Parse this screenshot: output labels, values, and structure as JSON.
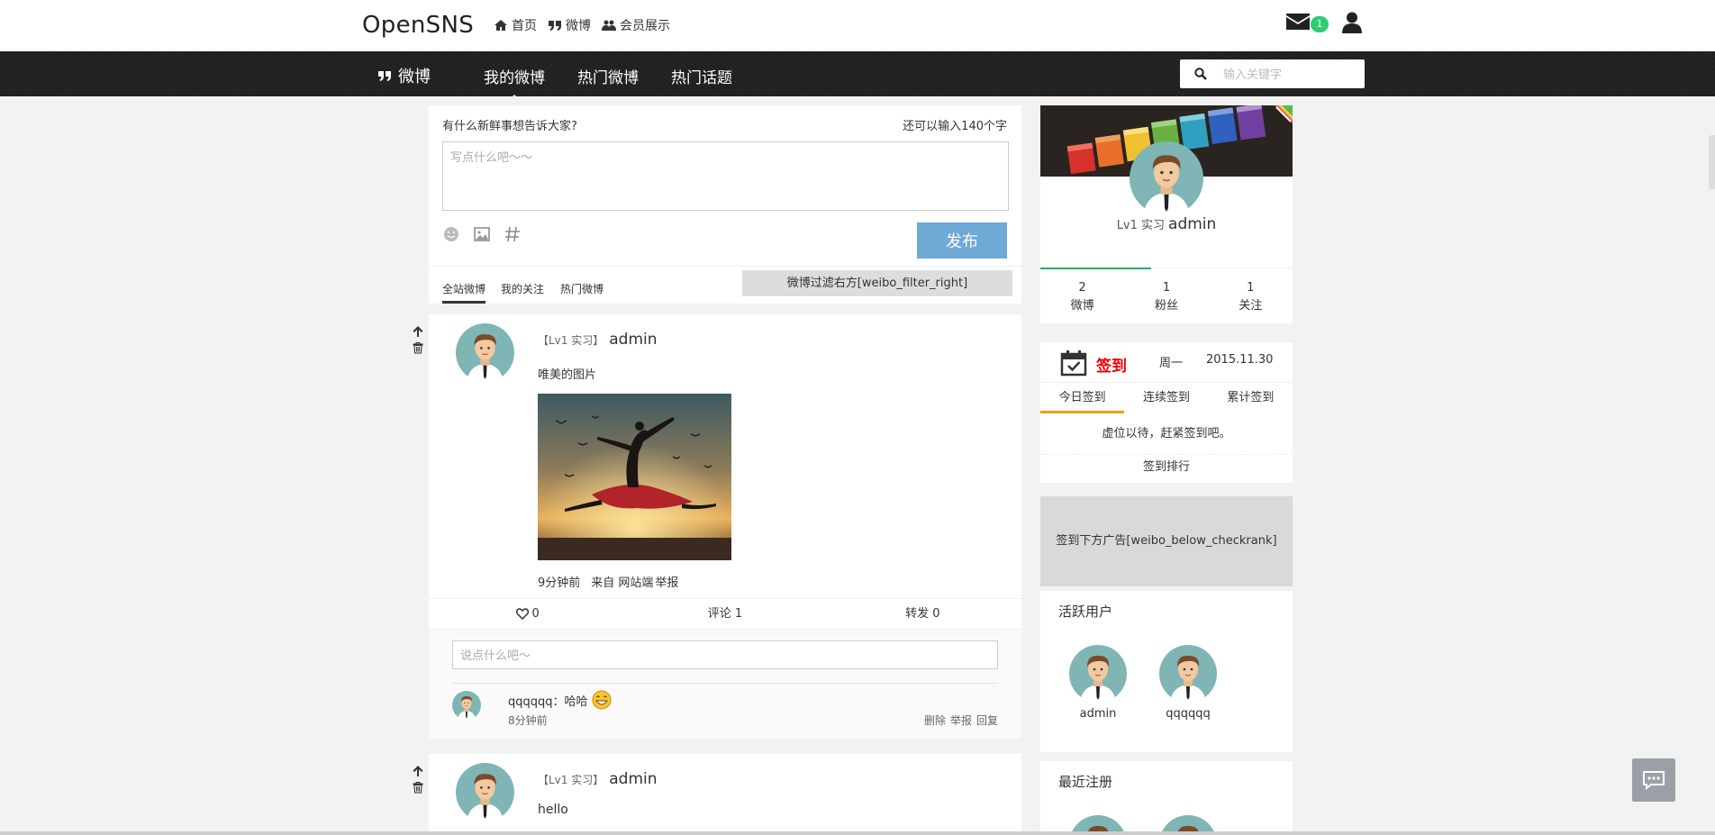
{
  "app": {
    "logo": "OpenSNS"
  },
  "topnav": [
    {
      "icon": "home-icon",
      "label": "首页"
    },
    {
      "icon": "quote-icon",
      "label": "微博"
    },
    {
      "icon": "users-icon",
      "label": "会员展示"
    }
  ],
  "notifications": {
    "count": "1"
  },
  "darknav": {
    "brand": "微博",
    "tabs": [
      "我的微博",
      "热门微博",
      "热门话题"
    ],
    "active_tab": "我的微博",
    "search_placeholder": "输入关键字"
  },
  "composer": {
    "prompt": "有什么新鲜事想告诉大家?",
    "remain": "还可以输入140个字",
    "placeholder": "写点什么吧～～",
    "publish": "发布",
    "filters": [
      "全站微博",
      "我的关注",
      "热门微博"
    ],
    "filter_ad": "微博过滤右方[weibo_filter_right]"
  },
  "posts": [
    {
      "level": "【Lv1 实习】",
      "user": "admin",
      "text": "唯美的图片",
      "time": "9分钟前",
      "source": "来自 网站端",
      "report": "举报",
      "likes": "0",
      "comments_label": "评论 1",
      "reposts_label": "转发 0",
      "comment_placeholder": "说点什么吧～",
      "comment": {
        "user": "qqqqqq",
        "text": "qqqqqq：哈哈",
        "time": "8分钟前",
        "ops": [
          "删除",
          "举报",
          "回复"
        ]
      }
    },
    {
      "level": "【Lv1 实习】",
      "user": "admin",
      "text": "hello"
    }
  ],
  "profile": {
    "level": "Lv1 实习",
    "name": "admin",
    "stats": [
      {
        "value": "2",
        "label": "微博"
      },
      {
        "value": "1",
        "label": "粉丝"
      },
      {
        "value": "1",
        "label": "关注"
      }
    ]
  },
  "checkin": {
    "title": "签到",
    "weekday": "周一",
    "date": "2015.11.30",
    "tabs": [
      "今日签到",
      "连续签到",
      "累计签到"
    ],
    "message": "虚位以待，赶紧签到吧。",
    "rank": "签到排行"
  },
  "ad_below_checkrank": "签到下方广告[weibo_below_checkrank]",
  "active_users": {
    "title": "活跃用户",
    "users": [
      "admin",
      "qqqqqq"
    ]
  },
  "recent": {
    "title": "最近注册"
  },
  "colors": {
    "primary_button": "#6fa9d6",
    "badge": "#2ecc71",
    "checkin_title": "#e00000",
    "active_tab": "#f39c12"
  }
}
